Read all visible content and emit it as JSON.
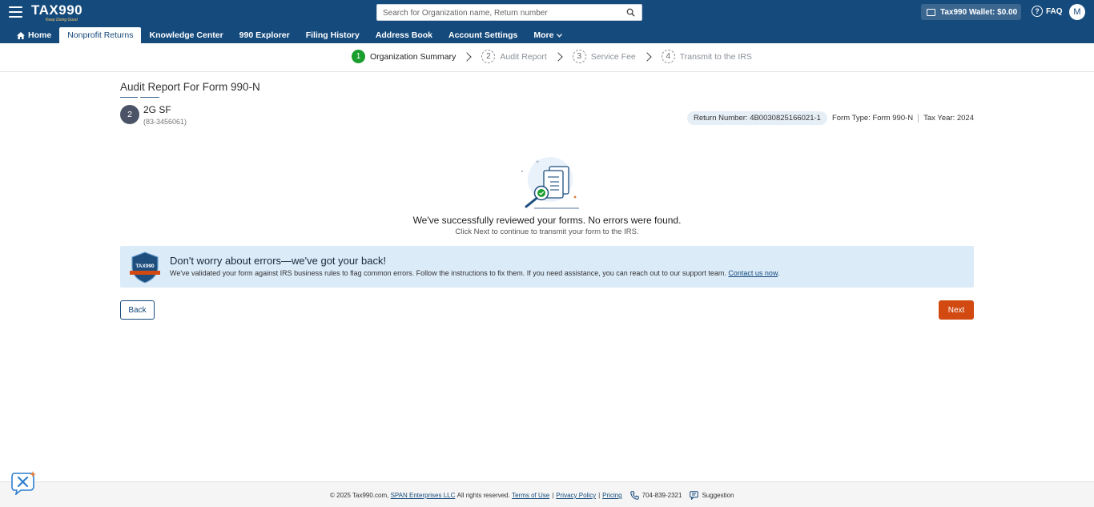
{
  "header": {
    "logo_text": "TAX990",
    "logo_tagline": "Keep Doing Good",
    "search_placeholder": "Search for Organization name, Return number",
    "wallet_label": "Tax990 Wallet: $0.00",
    "faq_label": "FAQ",
    "avatar_initial": "M"
  },
  "nav": {
    "tabs": [
      {
        "label": "Home",
        "active": false
      },
      {
        "label": "Nonprofit Returns",
        "active": true
      },
      {
        "label": "Knowledge Center",
        "active": false
      },
      {
        "label": "990 Explorer",
        "active": false
      },
      {
        "label": "Filing History",
        "active": false
      },
      {
        "label": "Address Book",
        "active": false
      },
      {
        "label": "Account Settings",
        "active": false
      },
      {
        "label": "More",
        "active": false
      }
    ]
  },
  "steps": [
    {
      "num": "1",
      "label": "Organization Summary",
      "status": "done"
    },
    {
      "num": "2",
      "label": "Audit Report",
      "status": "pending"
    },
    {
      "num": "3",
      "label": "Service Fee",
      "status": "pending"
    },
    {
      "num": "4",
      "label": "Transmit to the IRS",
      "status": "pending"
    }
  ],
  "main": {
    "page_title": "Audit Report For Form 990-N",
    "org_initial": "2",
    "org_name": "2G SF",
    "org_ein": "(83-3456061)",
    "return_number": "Return Number: 4B0030825166021-1",
    "form_type": "Form Type: Form 990-N",
    "tax_year": "Tax Year: 2024",
    "success_message": "We've successfully reviewed your forms. No errors were found.",
    "success_sub": "Click Next to continue to transmit your form to the IRS."
  },
  "banner": {
    "badge_text": "TAX990",
    "title": "Don't worry about errors—we've got your back!",
    "body": "We've validated your form against IRS business rules to flag common errors. Follow the instructions to fix them. If you need assistance, you can reach out to our support team.",
    "link": "Contact us now",
    "link_suffix": "."
  },
  "actions": {
    "back_label": "Back",
    "next_label": "Next"
  },
  "footer": {
    "copyright": "© 2025 Tax990.com,",
    "company_link": "SPAN Enterprises LLC",
    "rights": "All rights reserved.",
    "terms": "Terms of Use",
    "privacy": "Privacy Policy",
    "pricing": "Pricing",
    "phone": "704-839-2321",
    "suggestion": "Suggestion"
  },
  "colors": {
    "header_bg": "#154a7c",
    "step_done": "#1a9e2d",
    "next_button": "#d24a12",
    "banner_bg": "#dcebf8"
  }
}
